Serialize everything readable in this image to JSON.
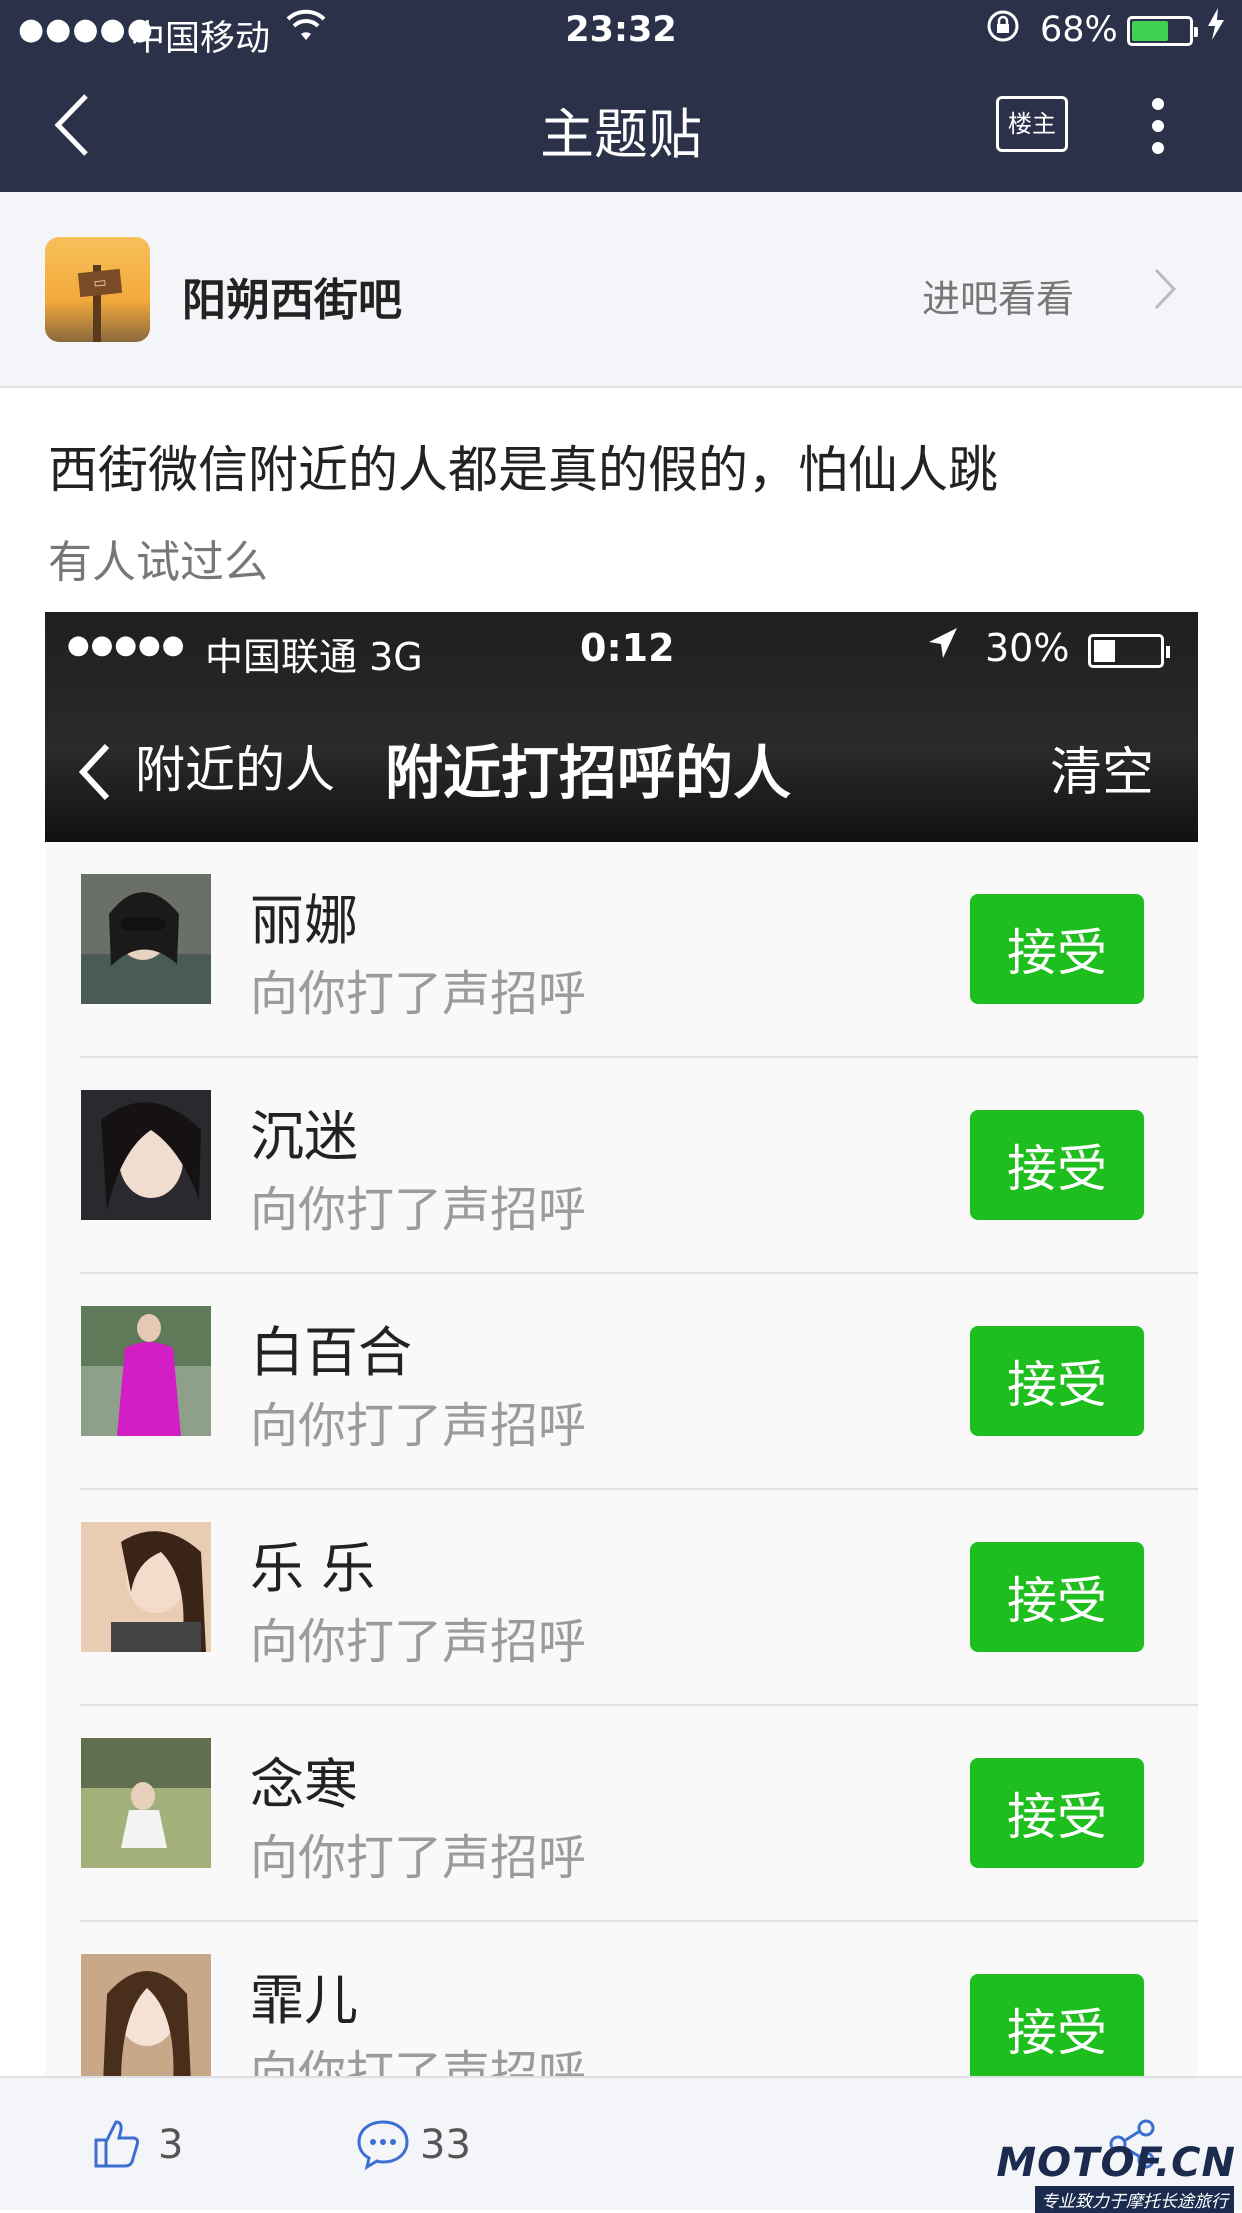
{
  "status_bar": {
    "signal": "●●●●●",
    "carrier": "中国移动",
    "time": "23:32",
    "battery_text": "68%",
    "battery_level": 0.68,
    "battery_color": "#3fd14f"
  },
  "nav": {
    "title": "主题贴",
    "owner_label": "楼主"
  },
  "forum": {
    "name": "阳朔西街吧",
    "visit_label": "进吧看看"
  },
  "post": {
    "title": "西街微信附近的人都是真的假的，怕仙人跳",
    "body": "有人试过么"
  },
  "embedded": {
    "signal": "●●●●●",
    "carrier": "中国联通  3G",
    "time": "0:12",
    "battery_text": "30%",
    "battery_level": 0.3,
    "back_label": "附近的人",
    "title": "附近打招呼的人",
    "clear_label": "清空",
    "accept_color": "#1fbe1f",
    "rows": [
      {
        "name": "丽娜",
        "message": "向你打了声招呼",
        "accept": "接受"
      },
      {
        "name": "沉迷",
        "message": "向你打了声招呼",
        "accept": "接受"
      },
      {
        "name": "白百合",
        "message": "向你打了声招呼",
        "accept": "接受"
      },
      {
        "name": "乐 乐",
        "message": "向你打了声招呼",
        "accept": "接受"
      },
      {
        "name": "念寒",
        "message": "向你打了声招呼",
        "accept": "接受"
      },
      {
        "name": "霏儿",
        "message": "向你打了声招呼",
        "accept": "接受"
      }
    ]
  },
  "bottom_bar": {
    "likes": "3",
    "comments": "33"
  },
  "watermark": {
    "site": "MOTOF.CN",
    "slogan": "专业致力于摩托长途旅行"
  }
}
